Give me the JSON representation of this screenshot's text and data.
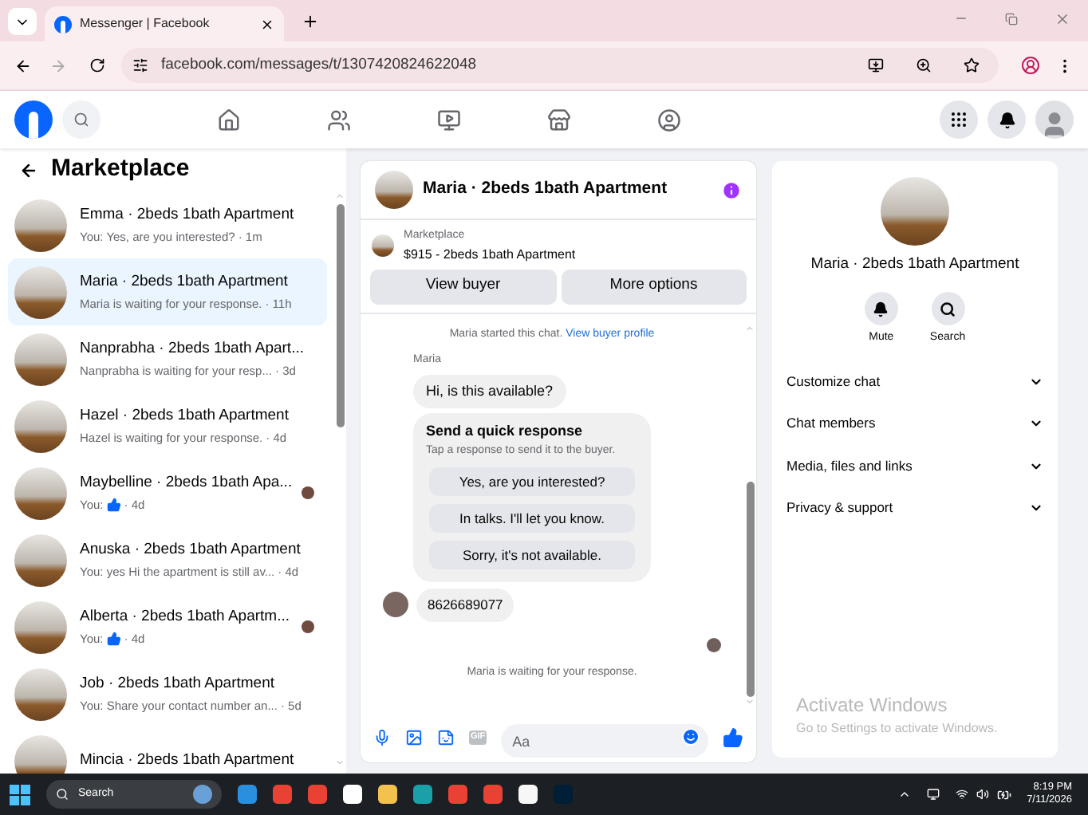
{
  "browser": {
    "tab_title": "Messenger | Facebook",
    "url": "facebook.com/messages/t/1307420824622048"
  },
  "sidebar": {
    "title": "Marketplace",
    "conversations": [
      {
        "title": "Emma · 2beds 1bath Apartment",
        "preview": "You: Yes, are you interested?",
        "like": false,
        "time": "· 1m",
        "selected": false,
        "seen": false
      },
      {
        "title": "Maria · 2beds 1bath Apartment",
        "preview": "Maria is waiting for your response.",
        "like": false,
        "time": "· 11h",
        "selected": true,
        "seen": false
      },
      {
        "title": "Nanprabha · 2beds 1bath Apart...",
        "preview": "Nanprabha is waiting for your resp...",
        "like": false,
        "time": "· 3d",
        "selected": false,
        "seen": false
      },
      {
        "title": "Hazel · 2beds 1bath Apartment",
        "preview": "Hazel is waiting for your response.",
        "like": false,
        "time": "· 4d",
        "selected": false,
        "seen": false
      },
      {
        "title": "Maybelline · 2beds 1bath Apa...",
        "preview": "You:",
        "like": true,
        "time": "· 4d",
        "selected": false,
        "seen": true
      },
      {
        "title": "Anuska · 2beds 1bath Apartment",
        "preview": "You: yes Hi the apartment is still av...",
        "like": false,
        "time": "· 4d",
        "selected": false,
        "seen": false
      },
      {
        "title": "Alberta · 2beds 1bath Apartm...",
        "preview": "You:",
        "like": true,
        "time": "· 4d",
        "selected": false,
        "seen": true
      },
      {
        "title": "Job · 2beds 1bath Apartment",
        "preview": "You: Share your contact number an...",
        "like": false,
        "time": "· 5d",
        "selected": false,
        "seen": false
      },
      {
        "title": "Mincia · 2beds 1bath Apartment",
        "selected": false,
        "like": false,
        "seen": false
      }
    ]
  },
  "chat": {
    "title": "Maria · 2beds 1bath Apartment",
    "listing": {
      "label": "Marketplace",
      "price_title": "$915 - 2beds 1bath Apartment"
    },
    "buttons": [
      "View buyer",
      "More options"
    ],
    "started_text": "Maria started this chat.",
    "profile_link": "View buyer profile",
    "messages": [
      {
        "kind": "sender",
        "text": "Maria"
      },
      {
        "kind": "bubble",
        "text": "Hi, is this available?"
      },
      {
        "kind": "quick",
        "title": "Send a quick response",
        "subtitle": "Tap a response to send it to the buyer.",
        "options": [
          "Yes, are you interested?",
          "In talks. I'll let you know.",
          "Sorry, it's not available."
        ]
      },
      {
        "kind": "avatar_bubble",
        "text": "8626689077"
      },
      {
        "kind": "seen"
      },
      {
        "kind": "status",
        "text": "Maria is waiting for your response."
      }
    ],
    "gif_label": "GIF",
    "input_placeholder": "Aa"
  },
  "details": {
    "title": "Maria · 2beds 1bath Apartment",
    "actions": [
      "Mute",
      "Search"
    ],
    "sections": [
      {
        "label": "Customize chat",
        "expanded": false
      },
      {
        "label": "Chat members",
        "expanded": false
      },
      {
        "label": "Media, files and links",
        "expanded": false
      },
      {
        "label": "Privacy & support",
        "expanded": false
      }
    ]
  },
  "activation": {
    "title": "Activate Windows",
    "subtitle": "Go to Settings to activate Windows."
  },
  "taskbar": {
    "search": "Search",
    "time": "8:19 PM",
    "date": "7/11/2026"
  }
}
